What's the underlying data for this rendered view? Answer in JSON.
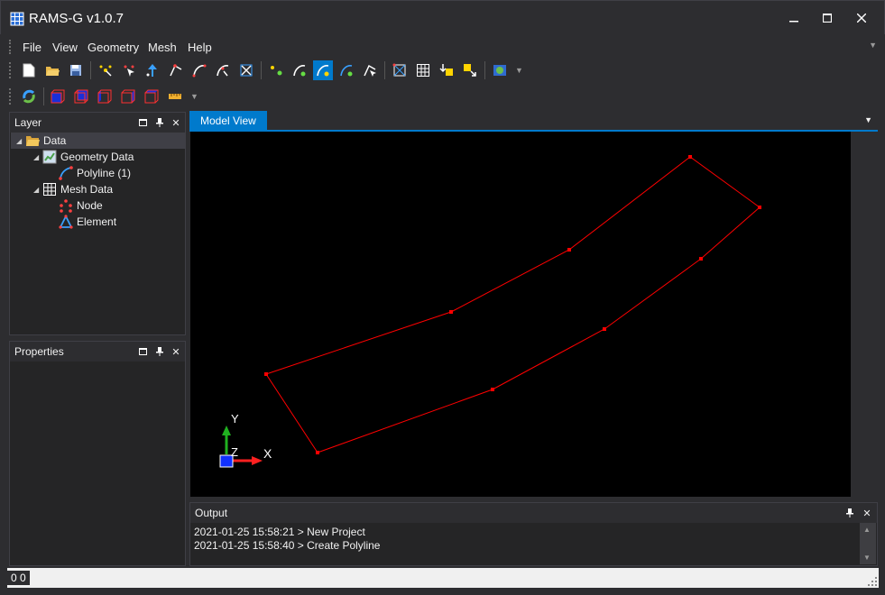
{
  "app": {
    "title": "RAMS-G v1.0.7"
  },
  "menu": {
    "items": [
      "File",
      "View",
      "Geometry",
      "Mesh",
      "Help"
    ]
  },
  "layer_panel": {
    "title": "Layer",
    "tree": [
      {
        "label": "Data",
        "icon": "folder-open-icon"
      },
      {
        "label": "Geometry Data",
        "icon": "geometry-data-icon"
      },
      {
        "label": "Polyline (1)",
        "icon": "polyline-icon"
      },
      {
        "label": "Mesh Data",
        "icon": "mesh-grid-icon"
      },
      {
        "label": "Node",
        "icon": "node-icon"
      },
      {
        "label": "Element",
        "icon": "element-icon"
      }
    ]
  },
  "properties_panel": {
    "title": "Properties"
  },
  "model_view": {
    "tab_label": "Model View",
    "axis_labels": {
      "x": "X",
      "y": "Y",
      "z": "Z"
    },
    "polyline_color": "#ff0000"
  },
  "output_panel": {
    "title": "Output",
    "lines": [
      "2021-01-25 15:58:21 > New Project",
      "2021-01-25 15:58:40 > Create Polyline"
    ]
  },
  "status": {
    "text": "0 0"
  },
  "colors": {
    "accent": "#007acc",
    "background": "#2d2d30",
    "panel": "#252526"
  }
}
